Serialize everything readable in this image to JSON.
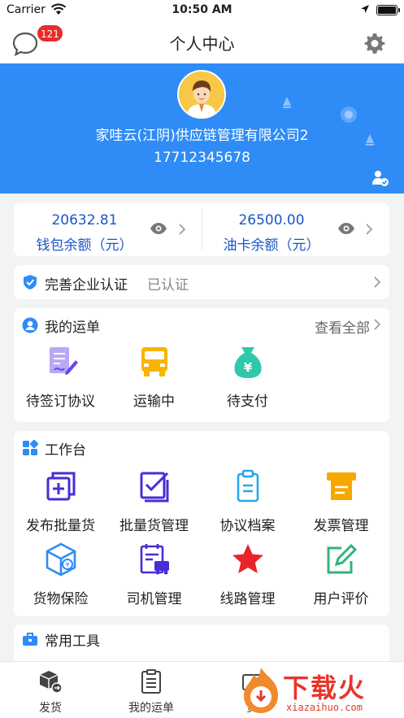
{
  "status_bar": {
    "carrier": "Carrier",
    "time": "10:50 AM"
  },
  "nav": {
    "title": "个人中心",
    "message_badge": "121"
  },
  "profile": {
    "company": "家哇云(江阴)供应链管理有限公司2",
    "phone": "17712345678"
  },
  "wallet": {
    "left": {
      "amount": "20632.81",
      "label": "钱包余额（元）"
    },
    "right": {
      "amount": "26500.00",
      "label": "油卡余额（元）"
    }
  },
  "verification": {
    "title": "完善企业认证",
    "status": "已认证"
  },
  "my_waybills": {
    "title": "我的运单",
    "view_all": "查看全部",
    "items": [
      {
        "label": "待签订协议",
        "icon": "contract-sign-icon"
      },
      {
        "label": "运输中",
        "icon": "truck-icon"
      },
      {
        "label": "待支付",
        "icon": "money-bag-icon"
      }
    ]
  },
  "workbench": {
    "title": "工作台",
    "items": [
      {
        "label": "发布批量货",
        "icon": "publish-batch-icon"
      },
      {
        "label": "批量货管理",
        "icon": "batch-manage-icon"
      },
      {
        "label": "协议档案",
        "icon": "clipboard-icon"
      },
      {
        "label": "发票管理",
        "icon": "invoice-printer-icon"
      },
      {
        "label": "货物保险",
        "icon": "cargo-insurance-icon"
      },
      {
        "label": "司机管理",
        "icon": "driver-manage-icon"
      },
      {
        "label": "线路管理",
        "icon": "star-icon"
      },
      {
        "label": "用户评价",
        "icon": "edit-review-icon"
      }
    ]
  },
  "common_tools": {
    "title": "常用工具"
  },
  "tab_bar": {
    "items": [
      {
        "label": "发货",
        "icon": "cube-ship-icon"
      },
      {
        "label": "我的运单",
        "icon": "document-list-icon"
      },
      {
        "label": "货",
        "icon": "cargo-icon"
      }
    ]
  },
  "watermark": {
    "text": "下载火",
    "url": "xiazaihuo.com"
  },
  "colors": {
    "brand_blue": "#2f8cf6",
    "amount_blue": "#1a55c8",
    "badge_red": "#e92b2b",
    "workbench_purple": "#4b2bd6"
  }
}
